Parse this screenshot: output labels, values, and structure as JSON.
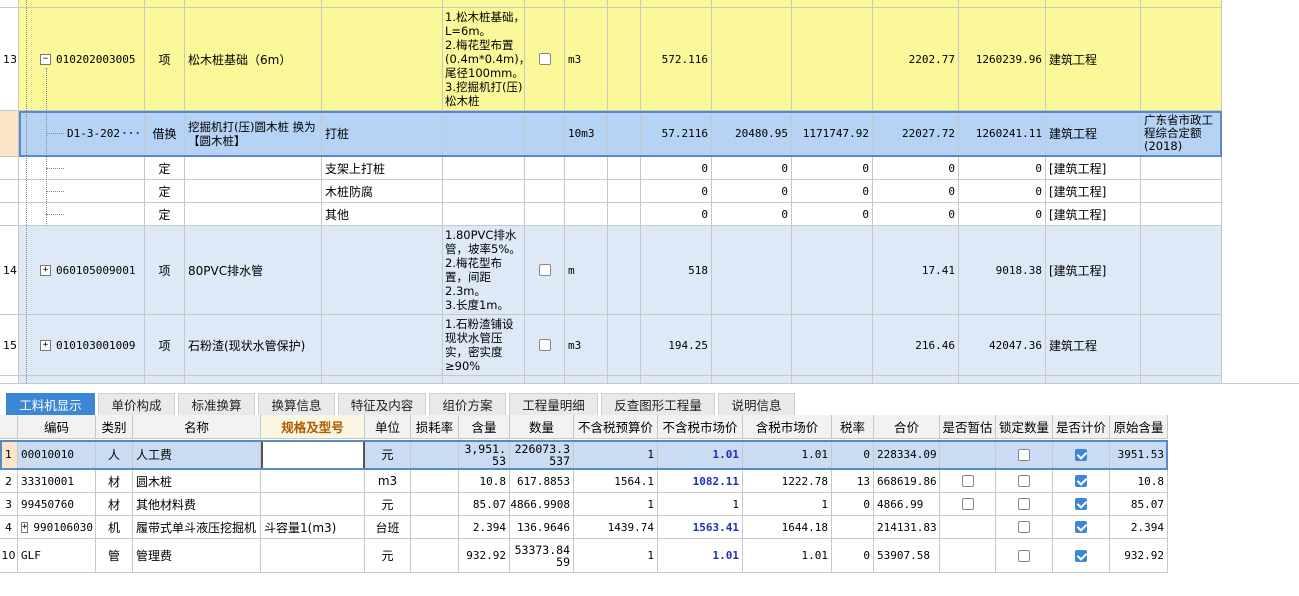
{
  "upper_grid": {
    "rows": [
      {
        "num": "13",
        "code": "010202003005",
        "type": "项",
        "name": "松木桩基础（6m）",
        "spec": "",
        "feature": "1.松木桩基础，L=6m。\n2.梅花型布置(0.4m*0.4m)，尾径100mm。\n3.挖掘机打(压)松木桩",
        "unit": "m3",
        "qty": "572.116",
        "v1": "",
        "v2": "",
        "unit_price": "2202.77",
        "total": "1260239.96",
        "major": "建筑工程",
        "quota": ""
      },
      {
        "num": "",
        "code": "D1-3-202",
        "type": "借换",
        "name": "挖掘机打(压)圆木桩  换为【圆木桩】",
        "spec": "打桩",
        "feature": "",
        "unit": "10m3",
        "qty": "57.2116",
        "v1": "20480.95",
        "v2": "1171747.92",
        "unit_price": "22027.72",
        "total": "1260241.11",
        "major": "建筑工程",
        "quota": "广东省市政工程综合定额(2018)",
        "more": "···"
      },
      {
        "type": "定",
        "spec": "支架上打桩",
        "qty": "0",
        "v1": "0",
        "v2": "0",
        "unit_price": "0",
        "total": "0",
        "major": "[建筑工程]"
      },
      {
        "type": "定",
        "spec": "木桩防腐",
        "qty": "0",
        "v1": "0",
        "v2": "0",
        "unit_price": "0",
        "total": "0",
        "major": "[建筑工程]"
      },
      {
        "type": "定",
        "spec": "其他",
        "qty": "0",
        "v1": "0",
        "v2": "0",
        "unit_price": "0",
        "total": "0",
        "major": "[建筑工程]"
      },
      {
        "num": "14",
        "code": "060105009001",
        "type": "项",
        "name": "80PVC排水管",
        "feature": "1.80PVC排水管，坡率5%。\n2.梅花型布置，间距2.3m。\n3.长度1m。",
        "unit": "m",
        "qty": "518",
        "unit_price": "17.41",
        "total": "9018.38",
        "major": "[建筑工程]"
      },
      {
        "num": "15",
        "code": "010103001009",
        "type": "项",
        "name": "石粉渣(现状水管保护)",
        "feature": "1.石粉渣铺设现状水管压实，密实度≥90%",
        "unit": "m3",
        "qty": "194.25",
        "unit_price": "216.46",
        "total": "42047.36",
        "major": "建筑工程"
      }
    ]
  },
  "tabs": [
    "工料机显示",
    "单价构成",
    "标准换算",
    "换算信息",
    "特征及内容",
    "组价方案",
    "工程量明细",
    "反查图形工程量",
    "说明信息"
  ],
  "bottom_grid": {
    "headers": [
      "编码",
      "类别",
      "名称",
      "规格及型号",
      "单位",
      "损耗率",
      "含量",
      "数量",
      "不含税预算价",
      "不含税市场价",
      "含税市场价",
      "税率",
      "合价",
      "是否暂估",
      "锁定数量",
      "是否计价",
      "原始含量"
    ],
    "rows": [
      {
        "idx": "1",
        "code": "00010010",
        "cat": "人",
        "name": "人工费",
        "spec": "",
        "unit": "元",
        "loss": "",
        "content": "3,951.53",
        "qty": "226073.3537",
        "budget": "1",
        "market": "1.01",
        "market_tax": "1.01",
        "tax": "0",
        "total": "228334.09",
        "est": false,
        "lock": false,
        "priced": true,
        "orig": "3951.53"
      },
      {
        "idx": "2",
        "code": "33310001",
        "cat": "材",
        "name": "圆木桩",
        "spec": "",
        "unit": "m3",
        "loss": "",
        "content": "10.8",
        "qty": "617.8853",
        "budget": "1564.1",
        "market": "1082.11",
        "market_tax": "1222.78",
        "tax": "13",
        "total": "668619.86",
        "est": false,
        "lock": false,
        "priced": true,
        "orig": "10.8"
      },
      {
        "idx": "3",
        "code": "99450760",
        "cat": "材",
        "name": "其他材料费",
        "spec": "",
        "unit": "元",
        "loss": "",
        "content": "85.07",
        "qty": "4866.9908",
        "budget": "1",
        "market": "1",
        "market_tax": "1",
        "tax": "0",
        "total": "4866.99",
        "est": false,
        "lock": false,
        "priced": true,
        "orig": "85.07"
      },
      {
        "idx": "4",
        "code": "990106030",
        "cat": "机",
        "name": "履带式单斗液压挖掘机",
        "spec": "斗容量1(m3)",
        "unit": "台班",
        "loss": "",
        "content": "2.394",
        "qty": "136.9646",
        "budget": "1439.74",
        "market": "1563.41",
        "market_tax": "1644.18",
        "tax": "",
        "total": "214131.83",
        "est": null,
        "lock": false,
        "priced": true,
        "orig": "2.394"
      },
      {
        "idx": "10",
        "code": "GLF",
        "cat": "管",
        "name": "管理费",
        "spec": "",
        "unit": "元",
        "loss": "",
        "content": "932.92",
        "qty": "53373.8459",
        "budget": "1",
        "market": "1.01",
        "market_tax": "1.01",
        "tax": "0",
        "total": "53907.58",
        "est": null,
        "lock": false,
        "priced": true,
        "orig": "932.92"
      }
    ]
  },
  "colors": {
    "yellow_row": "#fbf89a",
    "blue_row": "#dde9f7",
    "selected_row": "#b6d3f5",
    "active_tab": "#3b87d6",
    "market_price": "#1d2fbf"
  }
}
